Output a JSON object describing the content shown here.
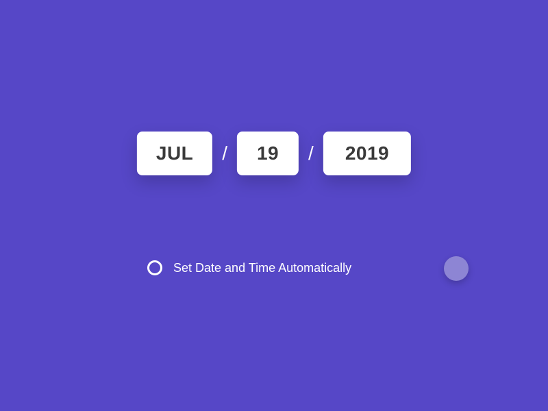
{
  "date": {
    "month": "JUL",
    "day": "19",
    "year": "2019",
    "separator": "/"
  },
  "toggle": {
    "label": "Set Date and Time Automatically"
  }
}
